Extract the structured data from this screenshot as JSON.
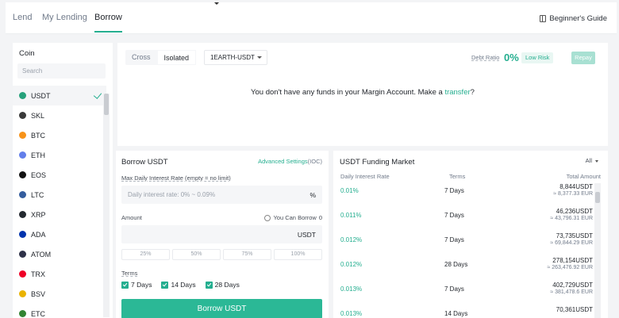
{
  "tabs": [
    {
      "label": "Lend"
    },
    {
      "label": "My Lending"
    },
    {
      "label": "Borrow",
      "active": true
    }
  ],
  "guide": {
    "label": "Beginner's Guide",
    "icon": "book-icon"
  },
  "coin_panel": {
    "title": "Coin",
    "search_placeholder": "Search",
    "coins": [
      {
        "symbol": "USDT",
        "color": "#26a17b",
        "selected": true
      },
      {
        "symbol": "SKL",
        "color": "#3a3a3a"
      },
      {
        "symbol": "BTC",
        "color": "#f7931a"
      },
      {
        "symbol": "ETH",
        "color": "#627eea"
      },
      {
        "symbol": "EOS",
        "color": "#111111"
      },
      {
        "symbol": "LTC",
        "color": "#345d9d"
      },
      {
        "symbol": "XRP",
        "color": "#23292f"
      },
      {
        "symbol": "ADA",
        "color": "#0033ad"
      },
      {
        "symbol": "ATOM",
        "color": "#2e3148"
      },
      {
        "symbol": "TRX",
        "color": "#ef0027"
      },
      {
        "symbol": "BSV",
        "color": "#eab300"
      },
      {
        "symbol": "ETC",
        "color": "#328332"
      }
    ]
  },
  "account": {
    "mode_cross": "Cross",
    "mode_isolated": "Isolated",
    "pair": "1EARTH-USDT",
    "debt_ratio_label": "Debt Ratio",
    "debt_ratio_value": "0%",
    "risk_label": "Low Risk",
    "repay_label": "Repay",
    "no_funds_text": "You don't have any funds in your Margin Account. Make a ",
    "no_funds_link": "transfer",
    "no_funds_end": "?"
  },
  "borrow": {
    "title": "Borrow USDT",
    "advanced_label": "Advanced Settings",
    "advanced_suffix": "(IOC)",
    "rate_label": "Max Daily Interest Rate (empty = no limit)",
    "rate_placeholder": "Daily interest rate: 0% ~ 0.09%",
    "rate_unit": "%",
    "amount_label": "Amount",
    "can_borrow_label": "You Can Borrow",
    "can_borrow_value": "0",
    "amount_unit": "USDT",
    "percent_options": [
      "25%",
      "50%",
      "75%",
      "100%"
    ],
    "terms_label": "Terms",
    "terms": [
      "7 Days",
      "14 Days",
      "28 Days"
    ],
    "button_label": "Borrow USDT",
    "accent": "#24ae8f"
  },
  "market": {
    "title": "USDT Funding Market",
    "filter": "All",
    "headers": {
      "rate": "Daily Interest Rate",
      "term": "Terms",
      "amount": "Total Amount"
    },
    "rows": [
      {
        "rate": "0.01%",
        "term": "7 Days",
        "amount": "8,844USDT",
        "sub": "≈ 8,377.33 EUR"
      },
      {
        "rate": "0.011%",
        "term": "7 Days",
        "amount": "46,236USDT",
        "sub": "≈ 43,796.31 EUR"
      },
      {
        "rate": "0.012%",
        "term": "7 Days",
        "amount": "73,735USDT",
        "sub": "≈ 69,844.29 EUR"
      },
      {
        "rate": "0.012%",
        "term": "28 Days",
        "amount": "278,154USDT",
        "sub": "≈ 263,476.92 EUR"
      },
      {
        "rate": "0.013%",
        "term": "7 Days",
        "amount": "402,729USDT",
        "sub": "≈ 381,478.6 EUR"
      },
      {
        "rate": "0.013%",
        "term": "14 Days",
        "amount": "70,361USDT",
        "sub": ""
      }
    ]
  }
}
